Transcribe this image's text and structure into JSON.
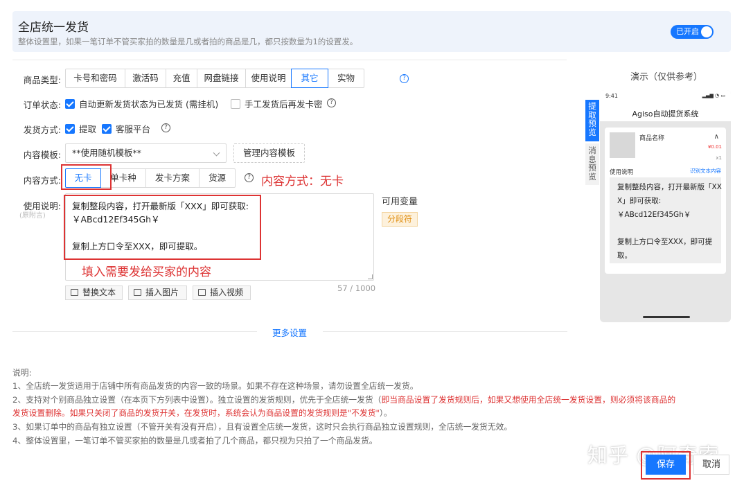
{
  "header": {
    "title": "全店统一发货",
    "description": "整体设置里，如果一笔订单不管买家拍的数量是几或者拍的商品是几，都只按数量为1的设置发。",
    "toggle_label": "已开启",
    "toggle_on": true
  },
  "form": {
    "product_type": {
      "label": "商品类型:",
      "options": [
        "卡号和密码",
        "激活码",
        "充值",
        "网盘链接",
        "使用说明",
        "其它",
        "实物"
      ],
      "selected": "其它"
    },
    "order_status": {
      "label": "订单状态:",
      "auto_update": "自动更新发货状态为已发货 (需挂机)",
      "auto_update_checked": true,
      "manual_resend": "手工发货后再发卡密",
      "manual_resend_checked": false
    },
    "ship_method": {
      "label": "发货方式:",
      "pickup": "提取",
      "pickup_checked": true,
      "service_platform": "客服平台",
      "service_platform_checked": true
    },
    "content_template": {
      "label": "内容模板:",
      "value": "**使用随机模板**",
      "manage_button": "管理内容模板"
    },
    "content_mode": {
      "label": "内容方式:",
      "options": [
        "无卡",
        "单卡种",
        "发卡方案",
        "货源"
      ],
      "selected": "无卡"
    },
    "instructions": {
      "label": "使用说明:",
      "sublabel": "(原附言)",
      "lines": [
        "复制整段内容，打开最新版「XXX」即可获取:",
        "￥ABcd12Ef345Gh￥",
        "",
        "复制上方口令至XXX，即可提取。"
      ],
      "counter": "57 / 1000",
      "buttons": [
        "替换文本",
        "插入图片",
        "插入视频"
      ]
    },
    "variables": {
      "label": "可用变量",
      "chip": "分段符"
    },
    "more_settings": "更多设置"
  },
  "annotations": {
    "content_mode_note": "内容方式：无卡",
    "fill_note": "填入需要发给买家的内容"
  },
  "notes": {
    "title": "说明:",
    "items": [
      "1、全店统一发货适用于店铺中所有商品发货的内容一致的场景。如果不存在这种场景，请勿设置全店统一发货。",
      "2、支持对个别商品独立设置（在本页下方列表中设置）。独立设置的发货规则，优先于全店统一发货（",
      "3、如果订单中的商品有独立设置（不管开关有没有开启），且有设置全店统一发货，这时只会执行商品独立设置规则，全店统一发货无效。",
      "4、整体设置里，一笔订单不管买家拍的数量是几或者拍了几个商品，都只视为只拍了一个商品发货。"
    ],
    "item2_red1": "即当商品设置了发货规则后，如果又想使用全店统一发货设置，则必须将该商品的",
    "item2_red2": "发货设置删除。如果只关闭了商品的发货开关，在发货时，系统会认为商品设置的发货规则是\"不发货\"",
    "item2_tail": "）。"
  },
  "preview": {
    "title": "演示（仅供参考）",
    "tabs": [
      "提取预览",
      "消息预览"
    ],
    "active_tab": "提取预览",
    "time": "9:41",
    "app_title": "Agiso自动提货系统",
    "product_name": "商品名称",
    "price": "¥0.01",
    "qty": "x1",
    "usage_label": "使用说明",
    "recognize_link": "识别文本内容",
    "lines": [
      "复制整段内容，打开最新版「XX",
      "X」即可获取:",
      "￥ABcd12Ef345Gh￥",
      "",
      "复制上方口令至XXX，即可提",
      "取。"
    ]
  },
  "footer": {
    "watermark": "知乎 @阿奇索",
    "save": "保存",
    "cancel": "取消"
  },
  "colors": {
    "primary": "#1677ff",
    "annotation_red": "#d33333",
    "chip_orange": "#e08f12"
  }
}
